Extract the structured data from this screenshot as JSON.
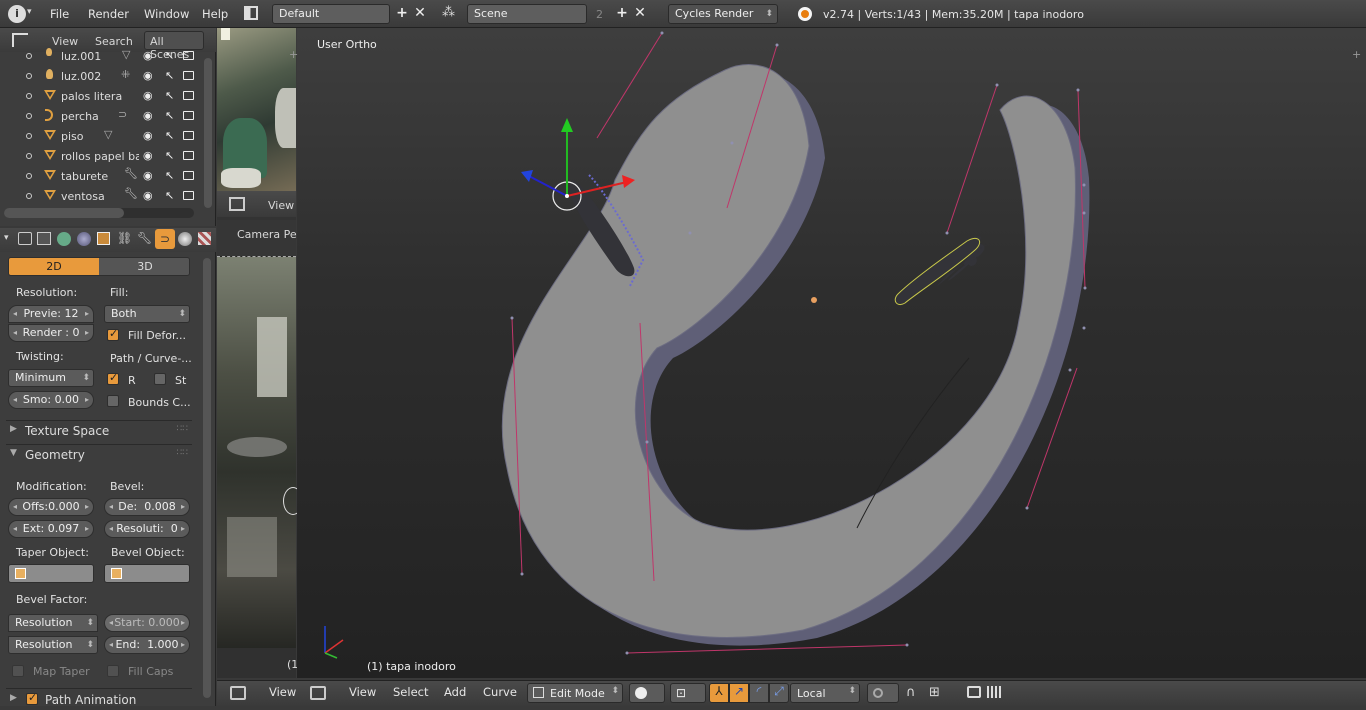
{
  "topbar": {
    "menus": [
      "File",
      "Render",
      "Window",
      "Help"
    ],
    "screen_layout": "Default",
    "scene": "Scene",
    "scene_users": "2",
    "engine": "Cycles Render",
    "info": "v2.74 | Verts:1/43 | Mem:35.20M | tapa inodoro"
  },
  "outliner": {
    "menus": [
      "View",
      "Search"
    ],
    "scope": "All Scenes",
    "items": [
      "luz.001",
      "luz.002",
      "palos litera",
      "percha",
      "piso",
      "rollos papel bath",
      "taburete",
      "ventosa"
    ]
  },
  "image_editor": {
    "view_label": "View",
    "camera_label": "Camera Pers"
  },
  "properties": {
    "tabs": [
      "2D",
      "3D"
    ],
    "active_tab": "2D",
    "resolution_label": "Resolution:",
    "fill_label": "Fill:",
    "preview": "Previe:",
    "preview_value": "12",
    "render": "Render :",
    "render_value": "0",
    "fill_value": "Both",
    "fill_deform": "Fill Defor...",
    "twisting_label": "Twisting:",
    "path_label": "Path / Curve-...",
    "twist_value": "Minimum",
    "radius_label": "R",
    "stretch_label": "St",
    "smooth": "Smo:",
    "smooth_value": "0.00",
    "bounds": "Bounds C...",
    "texture_space": "Texture Space",
    "geometry": "Geometry",
    "modification_label": "Modification:",
    "bevel_label": "Bevel:",
    "offset": "Offs:",
    "offset_value": "0.000",
    "depth": "De:",
    "depth_value": "0.008",
    "extrude": "Ext:",
    "extrude_value": "0.097",
    "resolution2": "Resoluti:",
    "resolution2_value": "0",
    "taper_label": "Taper Object:",
    "bevel_obj_label": "Bevel Object:",
    "bevel_factor_label": "Bevel Factor:",
    "bf_mode1": "Resolution",
    "bf_mode2": "Resolution",
    "start": "Start:",
    "start_value": "0.000",
    "end": "End:",
    "end_value": "1.000",
    "map_taper": "Map Taper",
    "fill_caps": "Fill Caps",
    "path_animation": "Path Animation"
  },
  "viewport": {
    "view_name": "User Ortho",
    "object_info": "(1) tapa inodoro",
    "object_info_left": "(1"
  },
  "vp_header": {
    "view": "View",
    "menus": [
      "View",
      "Select",
      "Add",
      "Curve"
    ],
    "mode": "Edit Mode",
    "orientation": "Local"
  },
  "colors": {
    "accent": "#e89a3c",
    "mesh": "#8f8f8f",
    "mesh_side": "#6e6e82",
    "handle": "#c0366a"
  }
}
